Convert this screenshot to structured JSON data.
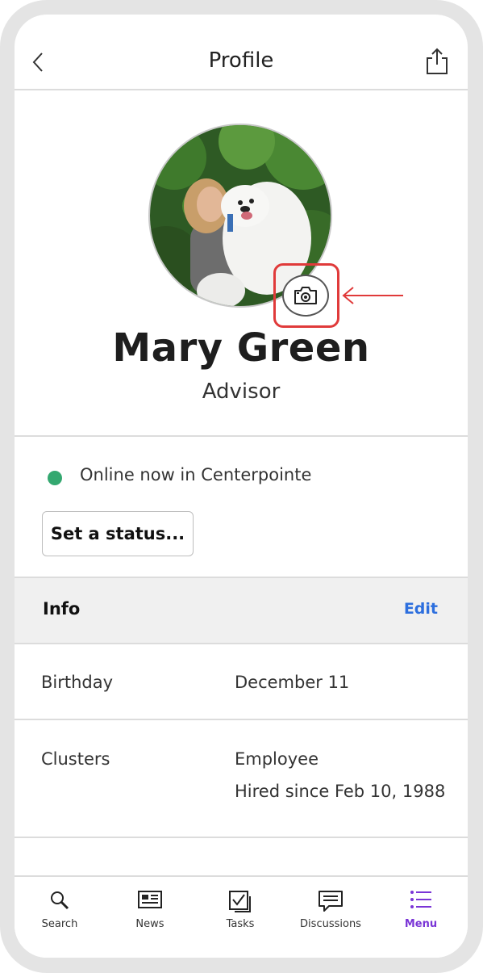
{
  "header": {
    "title": "Profile",
    "back_icon": "chevron-left-icon",
    "share_icon": "share-icon"
  },
  "profile": {
    "name": "Mary Green",
    "role": "Advisor",
    "camera_icon": "camera-icon"
  },
  "presence": {
    "status_text": "Online now in Centerpointe",
    "dot_color": "#34a870",
    "set_status_label": "Set a status..."
  },
  "info": {
    "title": "Info",
    "edit_label": "Edit",
    "accent": "#2d6fde",
    "rows": [
      {
        "label": "Birthday",
        "values": [
          "December 11"
        ]
      },
      {
        "label": "Clusters",
        "values": [
          "Employee",
          "Hired since Feb 10, 1988"
        ]
      }
    ]
  },
  "annotation": {
    "highlight_color": "#e03a3a"
  },
  "tabs": [
    {
      "label": "Search",
      "icon": "search-icon"
    },
    {
      "label": "News",
      "icon": "news-icon"
    },
    {
      "label": "Tasks",
      "icon": "tasks-icon"
    },
    {
      "label": "Discussions",
      "icon": "discussions-icon"
    },
    {
      "label": "Menu",
      "icon": "menu-list-icon",
      "active": true,
      "active_color": "#7a35d6"
    }
  ]
}
